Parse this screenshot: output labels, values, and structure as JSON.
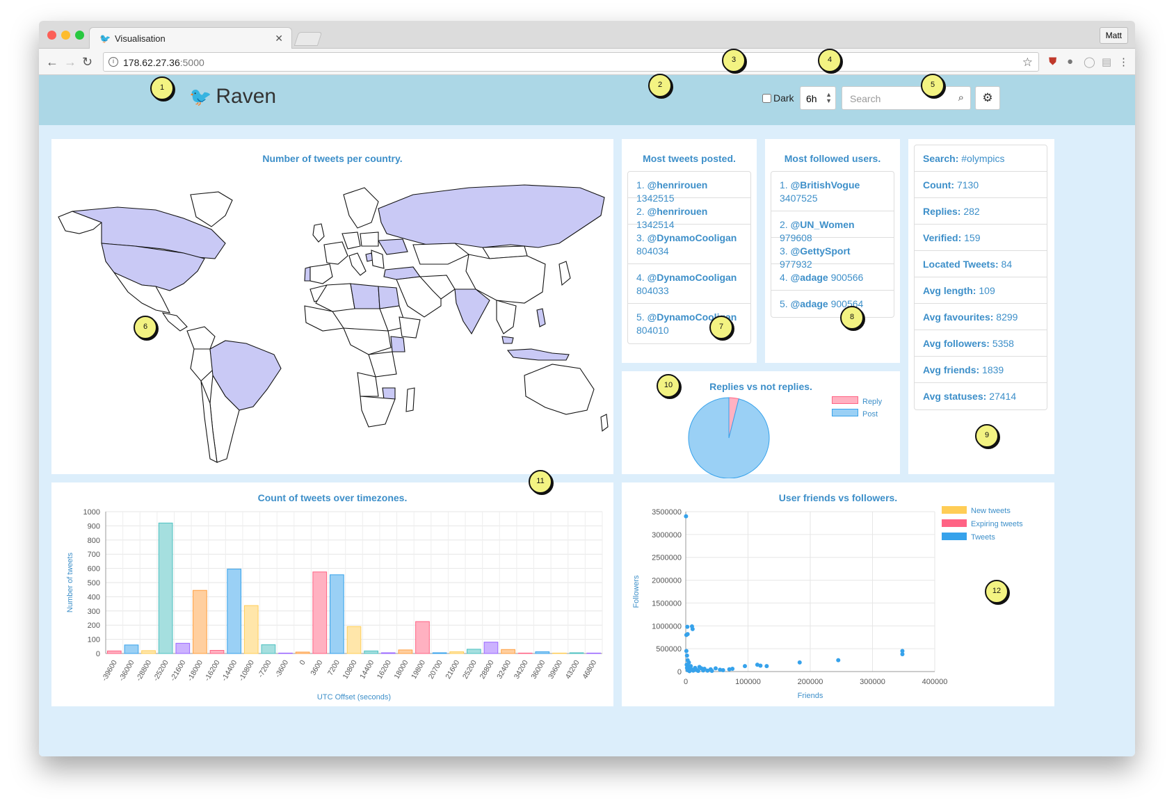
{
  "browser": {
    "tab_title": "Visualisation",
    "url_host": "178.62.27.36",
    "url_port": ":5000",
    "user": "Matt"
  },
  "navbar": {
    "brand": "Raven",
    "dark_label": "Dark",
    "window_value": "6h",
    "search_placeholder": "Search"
  },
  "map": {
    "title": "Number of tweets per country.",
    "highlighted_countries": [
      "Canada",
      "United States",
      "Brazil",
      "Russia",
      "Turkey",
      "Ukraine",
      "Libya",
      "Egypt",
      "India",
      "Philippines",
      "Kenya",
      "Malaysia",
      "Indonesia",
      "Portugal",
      "Zimbabwe",
      "Bosnia"
    ]
  },
  "most_tweets": {
    "title": "Most tweets posted.",
    "items": [
      {
        "rank": "1.",
        "user": "@henrirouen",
        "count": "1342515"
      },
      {
        "rank": "2.",
        "user": "@henrirouen",
        "count": "1342514"
      },
      {
        "rank": "3.",
        "user": "@DynamoCooligan",
        "count": "804034"
      },
      {
        "rank": "4.",
        "user": "@DynamoCooligan",
        "count": "804033"
      },
      {
        "rank": "5.",
        "user": "@DynamoCooligan",
        "count": "804010"
      }
    ]
  },
  "most_followed": {
    "title": "Most followed users.",
    "items": [
      {
        "rank": "1.",
        "user": "@BritishVogue",
        "count": "3407525"
      },
      {
        "rank": "2.",
        "user": "@UN_Women",
        "count": "979608"
      },
      {
        "rank": "3.",
        "user": "@GettySport",
        "count": "977932"
      },
      {
        "rank": "4.",
        "user": "@adage",
        "count": "900566"
      },
      {
        "rank": "5.",
        "user": "@adage",
        "count": "900564"
      }
    ]
  },
  "stats": [
    {
      "label": "Search:",
      "value": "#olympics"
    },
    {
      "label": "Count:",
      "value": "7130"
    },
    {
      "label": "Replies:",
      "value": "282"
    },
    {
      "label": "Verified:",
      "value": "159"
    },
    {
      "label": "Located Tweets:",
      "value": "84"
    },
    {
      "label": "Avg length:",
      "value": "109"
    },
    {
      "label": "Avg favourites:",
      "value": "8299"
    },
    {
      "label": "Avg followers:",
      "value": "5358"
    },
    {
      "label": "Avg friends:",
      "value": "1839"
    },
    {
      "label": "Avg statuses:",
      "value": "27414"
    }
  ],
  "annotations": [
    "1",
    "2",
    "3",
    "4",
    "5",
    "6",
    "7",
    "8",
    "9",
    "10",
    "11",
    "12"
  ],
  "colors": {
    "accent": "#3d8fc9",
    "navbar": "#acd7e6",
    "panel_border": "#dceefb",
    "map_fill": "#c9c9f5"
  },
  "chart_data": [
    {
      "type": "pie",
      "title": "Replies vs not replies.",
      "labels": [
        "Reply",
        "Post"
      ],
      "values": [
        282,
        6848
      ],
      "colors": [
        "#ffb1c1",
        "#9ad0f5"
      ],
      "legend": "top-right"
    },
    {
      "type": "bar",
      "title": "Count of tweets over timezones.",
      "xlabel": "UTC Offset (seconds)",
      "ylabel": "Number of tweets",
      "ylim": [
        0,
        1000
      ],
      "yticks": [
        0,
        100,
        200,
        300,
        400,
        500,
        600,
        700,
        800,
        900,
        1000
      ],
      "categories": [
        "-39600",
        "-36000",
        "-28800",
        "-25200",
        "-21600",
        "-18000",
        "-16200",
        "-14400",
        "-10800",
        "-7200",
        "-3600",
        "0",
        "3600",
        "7200",
        "10800",
        "14400",
        "16200",
        "18000",
        "19800",
        "20700",
        "21600",
        "25200",
        "28800",
        "32400",
        "34200",
        "36000",
        "39600",
        "43200",
        "46800"
      ],
      "values": [
        18,
        60,
        20,
        920,
        72,
        445,
        22,
        595,
        338,
        62,
        3,
        10,
        575,
        555,
        190,
        18,
        5,
        25,
        225,
        5,
        12,
        30,
        80,
        28,
        3,
        12,
        3,
        5,
        3
      ],
      "colors": [
        "#ffb1c1",
        "#9ad0f5",
        "#ffe6aa",
        "#a5dfdf",
        "#ccb2ff",
        "#ffcf9f",
        "#ffb1c1",
        "#9ad0f5",
        "#ffe6aa",
        "#a5dfdf",
        "#ccb2ff",
        "#ffcf9f",
        "#ffb1c1",
        "#9ad0f5",
        "#ffe6aa",
        "#a5dfdf",
        "#ccb2ff",
        "#ffcf9f",
        "#ffb1c1",
        "#9ad0f5",
        "#ffe6aa",
        "#a5dfdf",
        "#ccb2ff",
        "#ffcf9f",
        "#ffb1c1",
        "#9ad0f5",
        "#ffe6aa",
        "#a5dfdf",
        "#ccb2ff"
      ],
      "grid": true
    },
    {
      "type": "scatter",
      "title": "User friends vs followers.",
      "xlabel": "Friends",
      "ylabel": "Followers",
      "xlim": [
        0,
        400000
      ],
      "ylim": [
        0,
        3500000
      ],
      "xticks": [
        0,
        100000,
        200000,
        300000,
        400000
      ],
      "yticks": [
        0,
        500000,
        1000000,
        1500000,
        2000000,
        2500000,
        3000000,
        3500000
      ],
      "legend": [
        "New tweets",
        "Expiring tweets",
        "Tweets"
      ],
      "legend_colors": [
        "#ffcd56",
        "#ff6384",
        "#36a2eb"
      ],
      "grid": true,
      "points": [
        [
          400,
          3400000
        ],
        [
          1000,
          800000
        ],
        [
          3000,
          820000
        ],
        [
          2500,
          980000
        ],
        [
          10000,
          990000
        ],
        [
          11000,
          930000
        ],
        [
          1000,
          450000
        ],
        [
          2000,
          350000
        ],
        [
          3000,
          250000
        ],
        [
          5000,
          200000
        ],
        [
          1500,
          150000
        ],
        [
          8000,
          120000
        ],
        [
          15000,
          80000
        ],
        [
          22000,
          100000
        ],
        [
          25000,
          70000
        ],
        [
          30000,
          60000
        ],
        [
          40000,
          50000
        ],
        [
          48000,
          70000
        ],
        [
          55000,
          40000
        ],
        [
          60000,
          30000
        ],
        [
          70000,
          50000
        ],
        [
          75000,
          60000
        ],
        [
          95000,
          120000
        ],
        [
          115000,
          150000
        ],
        [
          120000,
          130000
        ],
        [
          130000,
          120000
        ],
        [
          183000,
          200000
        ],
        [
          245000,
          250000
        ],
        [
          348000,
          450000
        ],
        [
          348000,
          380000
        ],
        [
          5000,
          60000
        ],
        [
          10000,
          40000
        ],
        [
          12000,
          20000
        ],
        [
          18000,
          30000
        ],
        [
          20000,
          15000
        ],
        [
          28000,
          25000
        ],
        [
          35000,
          20000
        ],
        [
          42000,
          15000
        ],
        [
          3000,
          30000
        ],
        [
          6000,
          10000
        ],
        [
          9000,
          50000
        ],
        [
          14000,
          45000
        ],
        [
          2000,
          80000
        ],
        [
          4000,
          120000
        ],
        [
          7000,
          90000
        ]
      ]
    }
  ]
}
